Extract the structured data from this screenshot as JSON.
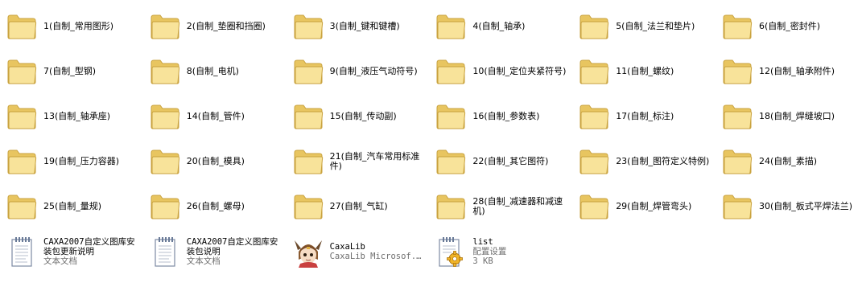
{
  "folders": [
    "1(自制_常用图形)",
    "2(自制_垫圈和挡圈)",
    "3(自制_键和键槽)",
    "4(自制_轴承)",
    "5(自制_法兰和垫片)",
    "6(自制_密封件)",
    "7(自制_型钢)",
    "8(自制_电机)",
    "9(自制_液压气动符号)",
    "10(自制_定位夹紧符号)",
    "11(自制_螺纹)",
    "12(自制_轴承附件)",
    "13(自制_轴承座)",
    "14(自制_管件)",
    "15(自制_传动副)",
    "16(自制_参数表)",
    "17(自制_标注)",
    "18(自制_焊缝坡口)",
    "19(自制_压力容器)",
    "20(自制_模具)",
    "21(自制_汽车常用标准件)",
    "22(自制_其它图符)",
    "23(自制_图符定义特例)",
    "24(自制_素描)",
    "25(自制_量规)",
    "26(自制_螺母)",
    "27(自制_气缸)",
    "28(自制_减速器和减速机)",
    "29(自制_焊管弯头)",
    "30(自制_板式平焊法兰)"
  ],
  "files": [
    {
      "name": "CAXA2007自定义图库安装包更新说明",
      "type": "文本文档",
      "size": "",
      "icon": "text-document-icon"
    },
    {
      "name": "CAXA2007自定义图库安装包说明",
      "type": "文本文档",
      "size": "",
      "icon": "text-document-icon"
    },
    {
      "name": "CaxaLib",
      "type": "CaxaLib Microsof...",
      "size": "",
      "icon": "anime-character-icon"
    },
    {
      "name": "list",
      "type": "配置设置",
      "size": "3 KB",
      "icon": "config-settings-icon"
    }
  ],
  "colors": {
    "folder_back": "#e8c560",
    "folder_front": "#f8e39a",
    "folder_edge": "#c9a23e"
  }
}
